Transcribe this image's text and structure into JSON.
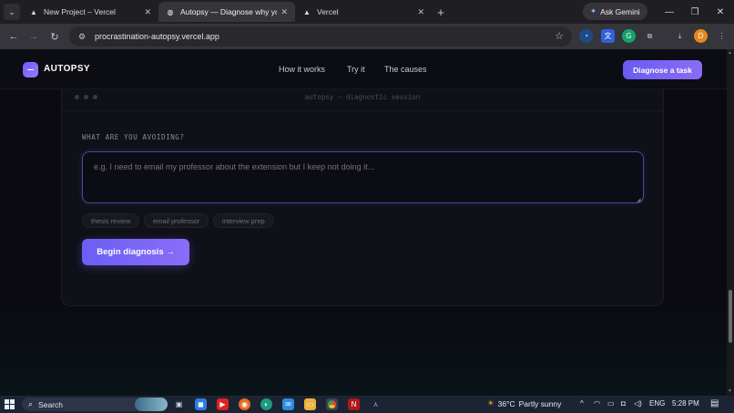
{
  "browser": {
    "tabs": [
      {
        "title": "New Project – Vercel",
        "favicon": "vercel-triangle-icon",
        "active": false
      },
      {
        "title": "Autopsy — Diagnose why you'r",
        "favicon": "globe-icon",
        "active": true
      },
      {
        "title": "Vercel",
        "favicon": "vercel-triangle-icon",
        "active": false
      }
    ],
    "new_tab": "+",
    "gemini_label": "Ask Gemini",
    "url": "procrastination-autopsy.vercel.app",
    "profile_initial": "D"
  },
  "site": {
    "logo_text": "AUTOPSY",
    "nav": [
      "How it works",
      "Try it",
      "The causes"
    ],
    "cta": "Diagnose a task"
  },
  "session": {
    "title": "autopsy — diagnostic session",
    "question_label": "WHAT ARE YOU AVOIDING?",
    "input_value": "",
    "input_placeholder": "e.g. I need to email my professor about the extension but I keep not doing it...",
    "chips": [
      "thesis review",
      "email professor",
      "interview prep"
    ],
    "submit": "Begin diagnosis →"
  },
  "taskbar": {
    "search_label": "Search",
    "weather_temp": "36°C",
    "weather_desc": "Partly sunny",
    "language": "ENG",
    "time": "5:28 PM"
  },
  "colors": {
    "accent": "#7a66f5",
    "page_bg": "#0a0a10",
    "card_bg": "#101018"
  }
}
